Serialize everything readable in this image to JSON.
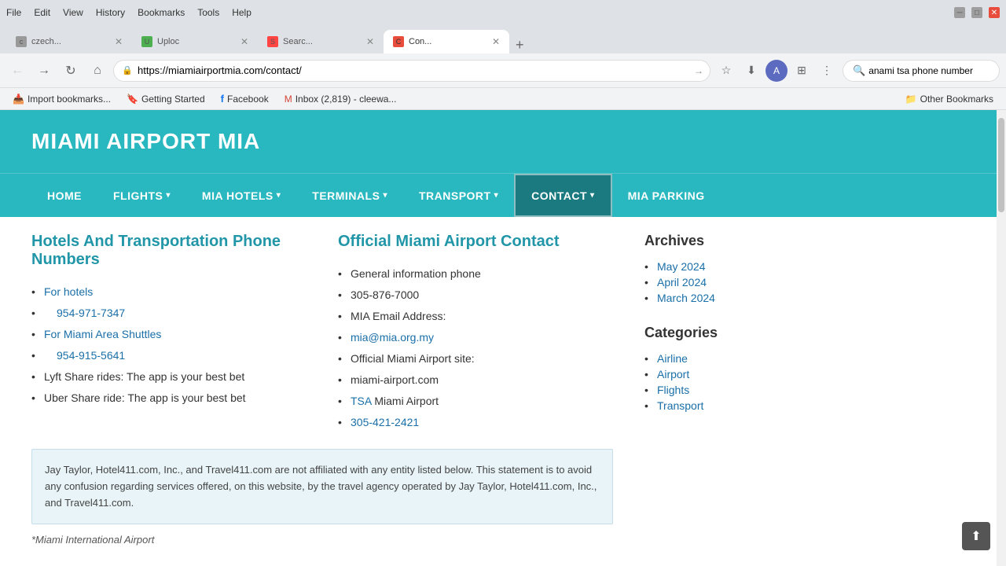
{
  "browser": {
    "menu_items": [
      "File",
      "Edit",
      "View",
      "History",
      "Bookmarks",
      "Tools",
      "Help"
    ],
    "tabs": [
      {
        "label": "Con...",
        "active": true,
        "favicon": "C"
      }
    ],
    "address": "https://miamiairportmia.com/contact/",
    "search_query": "anami tsa phone number",
    "bookmarks": [
      {
        "label": "Import bookmarks...",
        "icon": "📥"
      },
      {
        "label": "Getting Started",
        "icon": "🔖"
      },
      {
        "label": "Facebook",
        "icon": "f"
      },
      {
        "label": "Inbox (2,819) - cleewa...",
        "icon": "M"
      },
      {
        "label": "Other Bookmarks",
        "icon": "📁"
      }
    ]
  },
  "site": {
    "logo": "MIAMI AIRPORT MIA",
    "nav": {
      "items": [
        {
          "label": "HOME",
          "has_arrow": false
        },
        {
          "label": "FLIGHTS",
          "has_arrow": true
        },
        {
          "label": "MIA HOTELS",
          "has_arrow": true
        },
        {
          "label": "TERMINALS",
          "has_arrow": true
        },
        {
          "label": "TRANSPORT",
          "has_arrow": true
        },
        {
          "label": "CONTACT",
          "has_arrow": true,
          "active": true
        },
        {
          "label": "MIA PARKING",
          "has_arrow": false
        }
      ]
    }
  },
  "main": {
    "left_section_title": "Hotels And Transportation Phone Numbers",
    "right_section_title": "Official Miami Airport Contact",
    "left_items": [
      {
        "type": "link",
        "label": "For hotels"
      },
      {
        "type": "phone_indent",
        "label": "954-971-7347"
      },
      {
        "type": "link",
        "label": "For Miami Area Shuttles"
      },
      {
        "type": "phone_indent",
        "label": "954-915-5641"
      },
      {
        "type": "text",
        "label": "Lyft Share rides: The app is your best bet"
      },
      {
        "type": "text",
        "label": "Uber Share ride: The app is your best bet"
      }
    ],
    "right_items": [
      {
        "label": "General information phone"
      },
      {
        "label": "305-876-7000",
        "indent": true
      },
      {
        "label": "MIA Email Address:"
      },
      {
        "label": "mia@mia.org.my",
        "is_link": true
      },
      {
        "label": "Official Miami Airport site:"
      },
      {
        "label": "miami-airport.com",
        "indent": true
      },
      {
        "label": "TSA Miami Airport",
        "tsa_link": true
      },
      {
        "label": "305-421-2421",
        "is_link": true,
        "indent": true
      }
    ],
    "disclaimer": "Jay Taylor, Hotel411.com, Inc., and Travel411.com are not affiliated with any entity listed below. This statement is to avoid any confusion regarding services offered, on this website, by the travel agency operated by Jay Taylor, Hotel411.com, Inc., and Travel411.com.",
    "miami_note": "*Miami International Airport"
  },
  "sidebar": {
    "archives_title": "Archives",
    "archives": [
      {
        "label": "May 2024"
      },
      {
        "label": "April 2024"
      },
      {
        "label": "March 2024"
      }
    ],
    "categories_title": "Categories",
    "categories": [
      {
        "label": "Airline"
      },
      {
        "label": "Airport"
      },
      {
        "label": "Flights"
      },
      {
        "label": "Transport"
      }
    ]
  }
}
